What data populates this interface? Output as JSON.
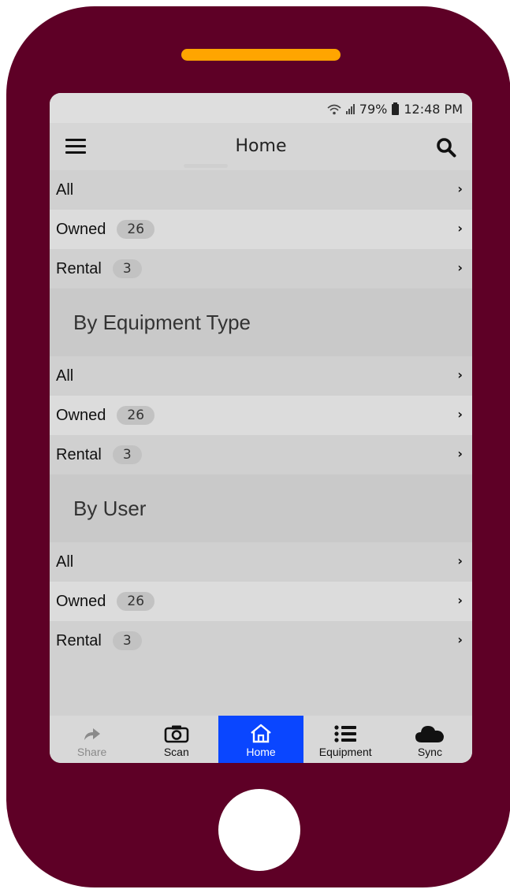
{
  "status_bar": {
    "battery": "79%",
    "time": "12:48 PM"
  },
  "app_bar": {
    "title": "Home"
  },
  "sections": [
    {
      "header": "",
      "rows": [
        {
          "label": "All",
          "count": ""
        },
        {
          "label": "Owned",
          "count": "26"
        },
        {
          "label": "Rental",
          "count": "3"
        }
      ]
    },
    {
      "header": "By Equipment Type",
      "rows": [
        {
          "label": "All",
          "count": ""
        },
        {
          "label": "Owned",
          "count": "26"
        },
        {
          "label": "Rental",
          "count": "3"
        }
      ]
    },
    {
      "header": "By User",
      "rows": [
        {
          "label": "All",
          "count": ""
        },
        {
          "label": "Owned",
          "count": "26"
        },
        {
          "label": "Rental",
          "count": "3"
        }
      ]
    }
  ],
  "tabs": [
    {
      "label": "Share",
      "icon": "share-icon",
      "state": "disabled"
    },
    {
      "label": "Scan",
      "icon": "camera-icon",
      "state": "normal"
    },
    {
      "label": "Home",
      "icon": "home-icon",
      "state": "active"
    },
    {
      "label": "Equipment",
      "icon": "list-icon",
      "state": "normal"
    },
    {
      "label": "Sync",
      "icon": "cloud-icon",
      "state": "normal"
    }
  ],
  "colors": {
    "phone_body": "#5e0026",
    "speaker": "#ffa500",
    "active_tab": "#0a46ff"
  }
}
